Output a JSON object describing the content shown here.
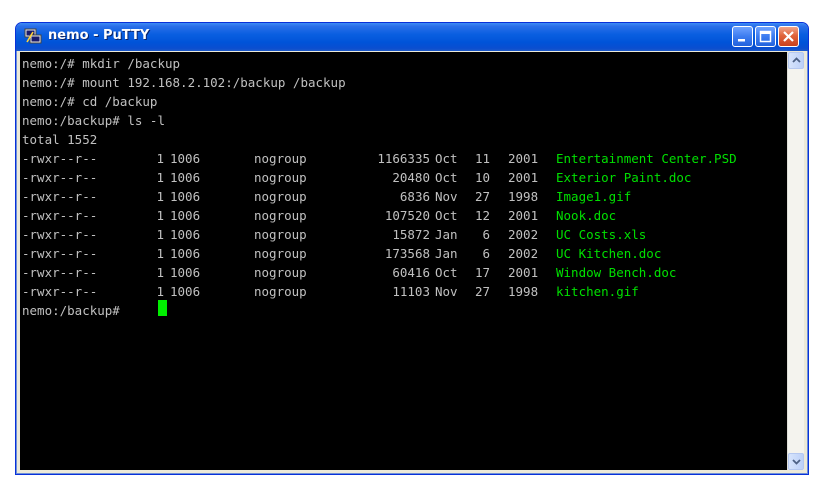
{
  "window": {
    "title": "nemo - PuTTY",
    "app_icon": "putty-icon",
    "controls": [
      "minimize-icon",
      "maximize-icon",
      "close-icon"
    ]
  },
  "terminal": {
    "lines": [
      "nemo:/# mkdir /backup",
      "nemo:/# mount 192.168.2.102:/backup /backup",
      "nemo:/# cd /backup",
      "nemo:/backup# ls -l",
      "total 1552"
    ],
    "listing": [
      {
        "perms": "-rwxr--r--",
        "links": "1",
        "owner": "1006",
        "group": "nogroup",
        "size": "1166335",
        "month": "Oct",
        "day": "11",
        "year": "2001",
        "name": "Entertainment Center.PSD"
      },
      {
        "perms": "-rwxr--r--",
        "links": "1",
        "owner": "1006",
        "group": "nogroup",
        "size": "20480",
        "month": "Oct",
        "day": "10",
        "year": "2001",
        "name": "Exterior Paint.doc"
      },
      {
        "perms": "-rwxr--r--",
        "links": "1",
        "owner": "1006",
        "group": "nogroup",
        "size": "6836",
        "month": "Nov",
        "day": "27",
        "year": "1998",
        "name": "Image1.gif"
      },
      {
        "perms": "-rwxr--r--",
        "links": "1",
        "owner": "1006",
        "group": "nogroup",
        "size": "107520",
        "month": "Oct",
        "day": "12",
        "year": "2001",
        "name": "Nook.doc"
      },
      {
        "perms": "-rwxr--r--",
        "links": "1",
        "owner": "1006",
        "group": "nogroup",
        "size": "15872",
        "month": "Jan",
        "day": "6",
        "year": "2002",
        "name": "UC Costs.xls"
      },
      {
        "perms": "-rwxr--r--",
        "links": "1",
        "owner": "1006",
        "group": "nogroup",
        "size": "173568",
        "month": "Jan",
        "day": "6",
        "year": "2002",
        "name": "UC Kitchen.doc"
      },
      {
        "perms": "-rwxr--r--",
        "links": "1",
        "owner": "1006",
        "group": "nogroup",
        "size": "60416",
        "month": "Oct",
        "day": "17",
        "year": "2001",
        "name": "Window Bench.doc"
      },
      {
        "perms": "-rwxr--r--",
        "links": "1",
        "owner": "1006",
        "group": "nogroup",
        "size": "11103",
        "month": "Nov",
        "day": "27",
        "year": "1998",
        "name": "kitchen.gif"
      }
    ],
    "prompt": "nemo:/backup#",
    "colors": {
      "background": "#000000",
      "text": "#c0c0c0",
      "filename": "#00e000",
      "cursor": "#00ee00"
    }
  },
  "scrollbar": {
    "icons": [
      "scroll-up-arrow-icon",
      "scroll-down-arrow-icon"
    ]
  }
}
